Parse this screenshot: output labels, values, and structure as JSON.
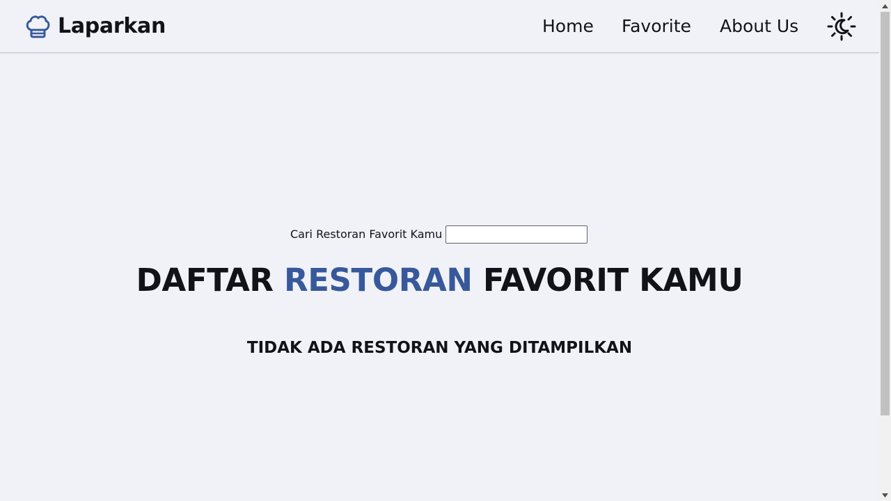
{
  "navbar": {
    "brand_name": "Laparkan",
    "brand_icon": "chef-hat-icon",
    "links": {
      "home": "Home",
      "favorite": "Favorite",
      "about": "About Us"
    },
    "theme_toggle_icon": "sun-moon-icon"
  },
  "search": {
    "label": "Cari Restoran Favorit Kamu",
    "value": "",
    "placeholder": ""
  },
  "main": {
    "title_part1": "DAFTAR ",
    "title_accent": "RESTORAN",
    "title_part2": " FAVORIT KAMU",
    "empty_message": "TIDAK ADA RESTORAN YANG DITAMPILKAN"
  },
  "colors": {
    "background": "#f1f2f7",
    "accent": "#37599b",
    "text": "#111318"
  }
}
